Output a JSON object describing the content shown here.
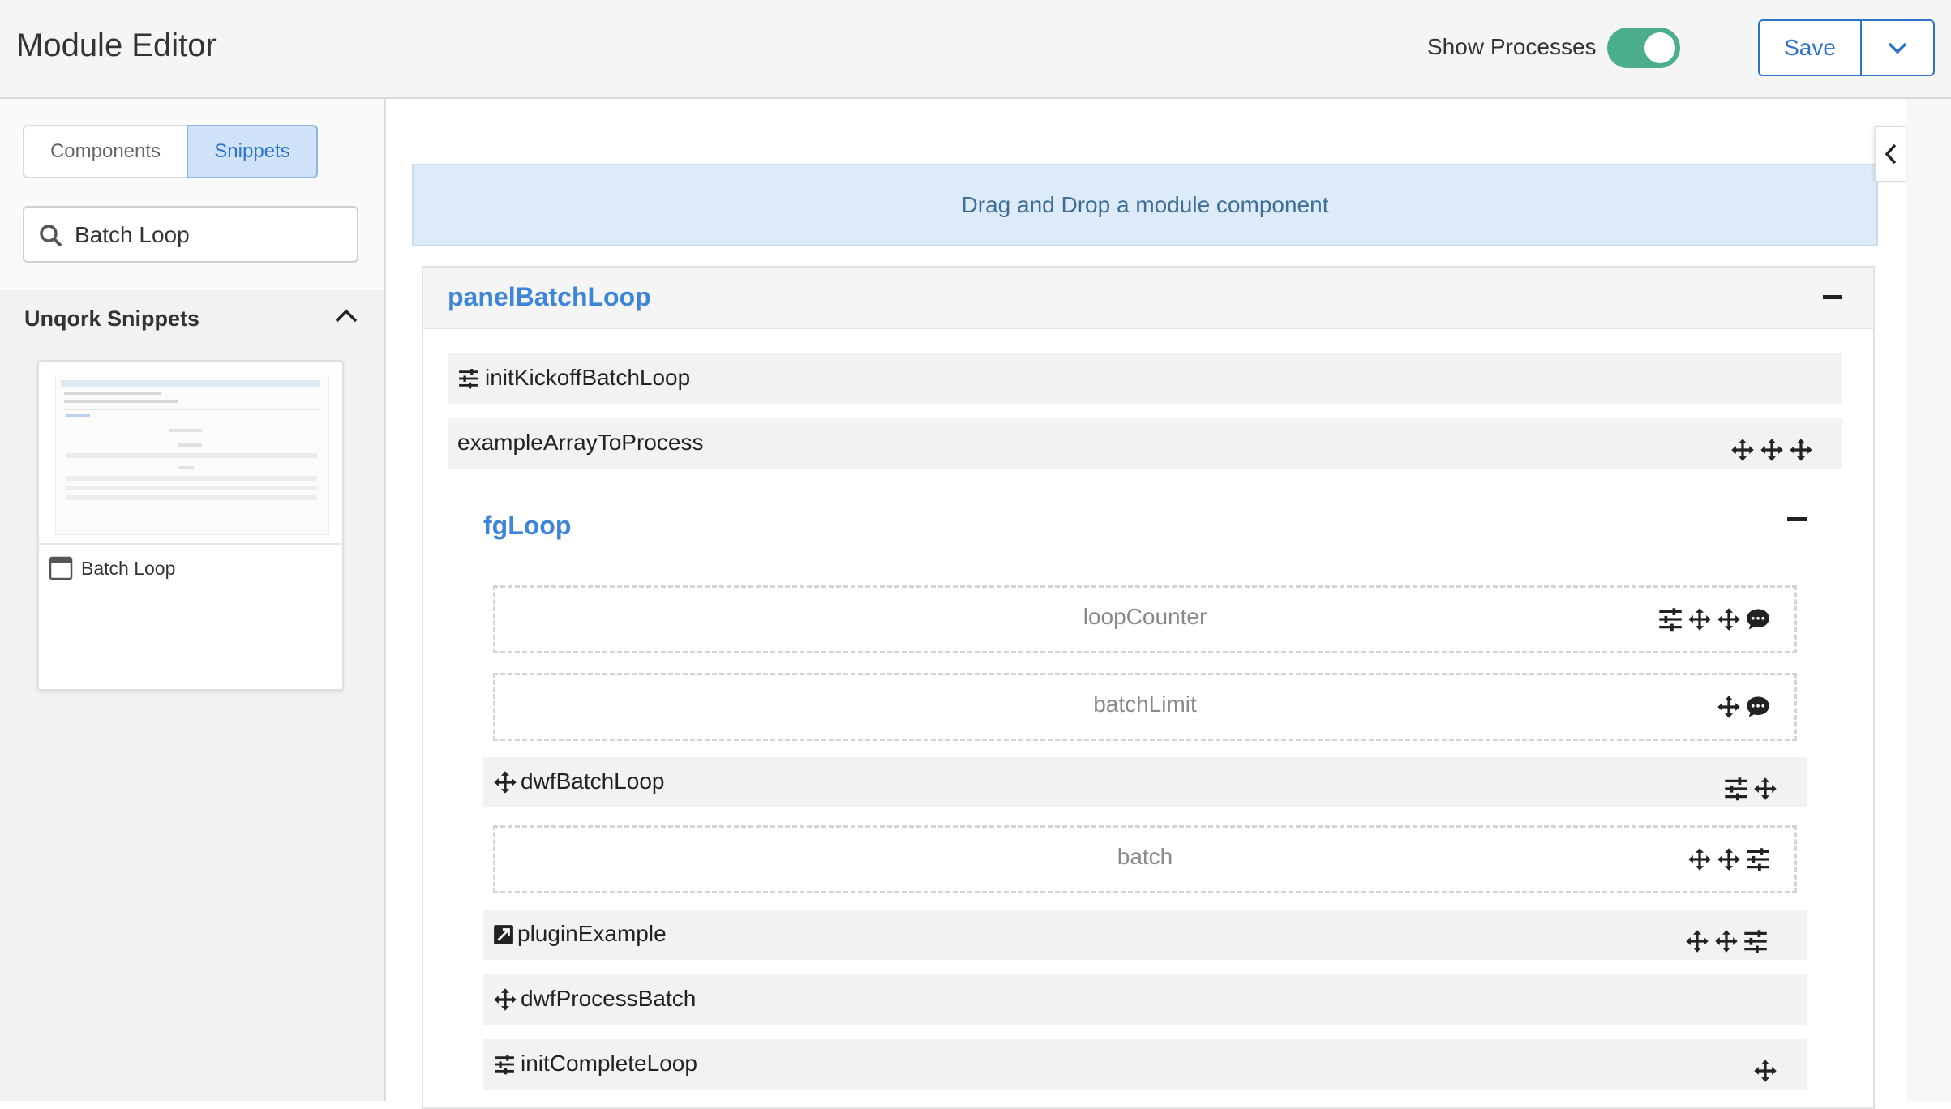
{
  "header": {
    "title": "Module Editor",
    "show_processes_label": "Show Processes",
    "show_processes_on": true,
    "save_label": "Save"
  },
  "sidebar": {
    "tabs": [
      {
        "label": "Components",
        "active": false
      },
      {
        "label": "Snippets",
        "active": true
      }
    ],
    "search": {
      "value": "Batch Loop"
    },
    "section_title": "Unqork Snippets",
    "snippets": [
      {
        "label": "Batch Loop",
        "icon": "panel-icon"
      }
    ]
  },
  "main": {
    "drop_zone_text": "Drag and Drop a module component",
    "panel": {
      "title": "panelBatchLoop",
      "rows": [
        {
          "label": "initKickoffBatchLoop",
          "icon": "initializer-icon",
          "process_icons": []
        },
        {
          "label": "exampleArrayToProcess",
          "icon": "",
          "process_icons": [
            "move-icon",
            "move-icon",
            "move-icon"
          ]
        }
      ],
      "field_group": {
        "title": "fgLoop",
        "items": [
          {
            "label": "loopCounter",
            "hidden": true,
            "icon": "",
            "process_icons": [
              "initializer-icon",
              "move-icon",
              "move-icon",
              "comment-icon"
            ]
          },
          {
            "label": "batchLimit",
            "hidden": true,
            "icon": "",
            "process_icons": [
              "move-icon",
              "comment-icon"
            ]
          },
          {
            "label": "dwfBatchLoop",
            "hidden": false,
            "icon": "move-icon",
            "process_icons": [
              "initializer-icon",
              "move-icon"
            ]
          },
          {
            "label": "batch",
            "hidden": true,
            "icon": "",
            "process_icons": [
              "move-icon",
              "move-icon",
              "initializer-icon"
            ]
          },
          {
            "label": "pluginExample",
            "hidden": false,
            "icon": "plugin-icon",
            "process_icons": [
              "move-icon",
              "move-icon",
              "initializer-icon"
            ]
          },
          {
            "label": "dwfProcessBatch",
            "hidden": false,
            "icon": "move-icon",
            "process_icons": []
          },
          {
            "label": "initCompleteLoop",
            "hidden": false,
            "icon": "initializer-icon",
            "process_icons": [
              "move-icon"
            ]
          }
        ]
      }
    }
  },
  "colors": {
    "accent": "#2d73cc",
    "toggle_on": "#4caf8c",
    "title_blue": "#3d85d8",
    "drop_zone_bg": "#dcebf7"
  }
}
